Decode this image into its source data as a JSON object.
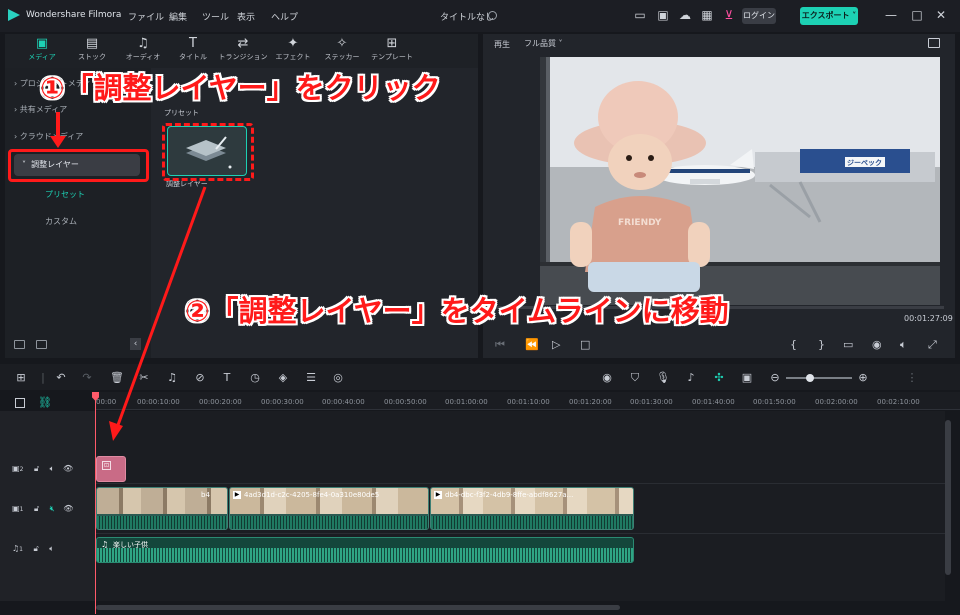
{
  "app": {
    "name": "Wondershare Filmora",
    "doc_title": "タイトルなし",
    "login": "ログイン",
    "export": "エクスポート"
  },
  "menu": [
    "ファイル",
    "編集",
    "ツール",
    "表示",
    "ヘルプ"
  ],
  "toolbar": [
    {
      "label": "メディア",
      "icon": "media-icon"
    },
    {
      "label": "ストック",
      "icon": "stock-icon"
    },
    {
      "label": "オーディオ",
      "icon": "audio-icon"
    },
    {
      "label": "タイトル",
      "icon": "title-icon"
    },
    {
      "label": "トランジション",
      "icon": "transition-icon"
    },
    {
      "label": "エフェクト",
      "icon": "effect-icon"
    },
    {
      "label": "ステッカー",
      "icon": "sticker-icon"
    },
    {
      "label": "テンプレート",
      "icon": "template-icon"
    }
  ],
  "sidebar": {
    "items": [
      "プロジェクトメディア",
      "共有メディア",
      "クラウドメディア",
      "調整レイヤー"
    ],
    "sub": [
      "プリセット",
      "カスタム"
    ]
  },
  "library": {
    "section": "プリセット",
    "item_label": "調整レイヤー"
  },
  "preview": {
    "play_label": "再生",
    "quality": "フル品質",
    "time": "00:01:27:09",
    "sign_text": "ジーペック"
  },
  "ruler": [
    "00:00",
    "00:00:10:00",
    "00:00:20:00",
    "00:00:30:00",
    "00:00:40:00",
    "00:00:50:00",
    "00:01:00:00",
    "00:01:10:00",
    "00:01:20:00",
    "00:01:30:00",
    "00:01:40:00",
    "00:01:50:00",
    "00:02:00:00",
    "00:02:10:00"
  ],
  "tracks": {
    "video2": "2",
    "video1": "1",
    "audio1": "1",
    "clip1": "b4",
    "clip2": "4ad3d1d-c2c-4205-8fe4-0a310e80de5",
    "clip3": "db4-dbc-f3f2-4db9-8ffe-abdf8627a...",
    "audio_clip": "楽しい子供"
  },
  "annotations": {
    "step1": "①「調整レイヤー」をクリック",
    "step2": "②「調整レイヤー」をタイムラインに移動"
  },
  "colors": {
    "accent": "#1dd1b4",
    "annotation": "#ff1a1a",
    "audio_wave": "#1f7a62",
    "adjust_clip": "#c96b86"
  }
}
